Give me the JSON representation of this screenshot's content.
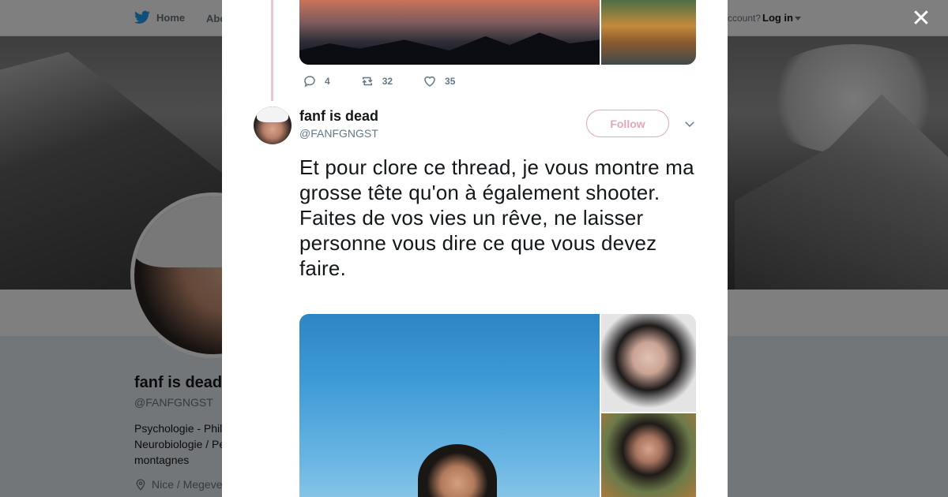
{
  "topnav": {
    "home_label": "Home",
    "about_label": "Abo",
    "account_prompt": "ccount?",
    "login_label": "Log in"
  },
  "profile": {
    "name": "fanf is dead",
    "handle": "@FANFGNGST",
    "bio": "Psychologie - Phil Neurobiologie / Pe les montagnes",
    "location": "Nice / Megeve"
  },
  "previous_tweet": {
    "reply_count": "4",
    "retweet_count": "32",
    "like_count": "35"
  },
  "tweet": {
    "author_name": "fanf is dead",
    "author_handle": "@FANFGNGST",
    "follow_label": "Follow",
    "text_line1": "Et pour clore ce thread, je vous montre ma grosse tête qu'on à également shooter.",
    "text_line2": "Faites de vos vies un rêve, ne laisser personne vous dire ce que vous devez faire."
  },
  "colors": {
    "accent": "#e0a7b4",
    "thread_line": "#f0c5cd",
    "twitter_blue": "#1da1f2",
    "overlay": "rgba(0,0,0,0.5)"
  },
  "icons": {
    "brand": "twitter-bird-icon",
    "reply": "reply-icon",
    "retweet": "retweet-icon",
    "like": "heart-icon",
    "close": "close-icon",
    "more": "chevron-down-icon",
    "location": "location-pin-icon"
  }
}
